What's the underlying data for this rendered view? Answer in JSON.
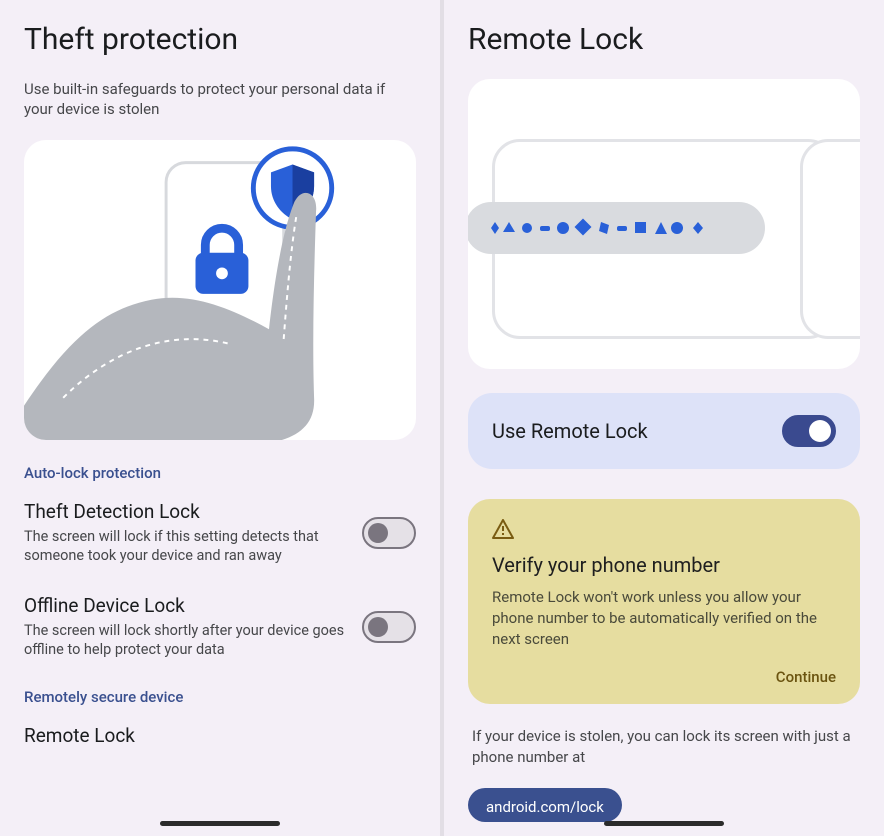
{
  "left": {
    "title": "Theft protection",
    "subtitle": "Use built-in safeguards to protect your personal data if your device is stolen",
    "section_auto_label": "Auto-lock protection",
    "theft_detection": {
      "title": "Theft Detection Lock",
      "desc": "The screen will lock if this setting detects that someone took your device and ran away"
    },
    "offline_lock": {
      "title": "Offline Device Lock",
      "desc": "The screen will lock shortly after your device goes offline to help protect your data"
    },
    "section_remote_label": "Remotely secure device",
    "remote_lock_title": "Remote Lock"
  },
  "right": {
    "title": "Remote Lock",
    "toggle_label": "Use Remote Lock",
    "warning": {
      "title": "Verify your phone number",
      "body": "Remote Lock won't work unless you allow your phone number to be automatically verified on the next screen",
      "action": "Continue"
    },
    "info": "If your device is stolen, you can lock its screen with just a phone number at",
    "chip": "android.com/lock"
  },
  "icons": {
    "lock": "lock-icon",
    "shield": "shield-icon",
    "warning": "warning-triangle-icon"
  },
  "colors": {
    "accent_blue": "#2960d8",
    "toggle_on": "#3a4a8f",
    "warning_bg": "#e6dda0",
    "label_blue": "#3a508f"
  }
}
